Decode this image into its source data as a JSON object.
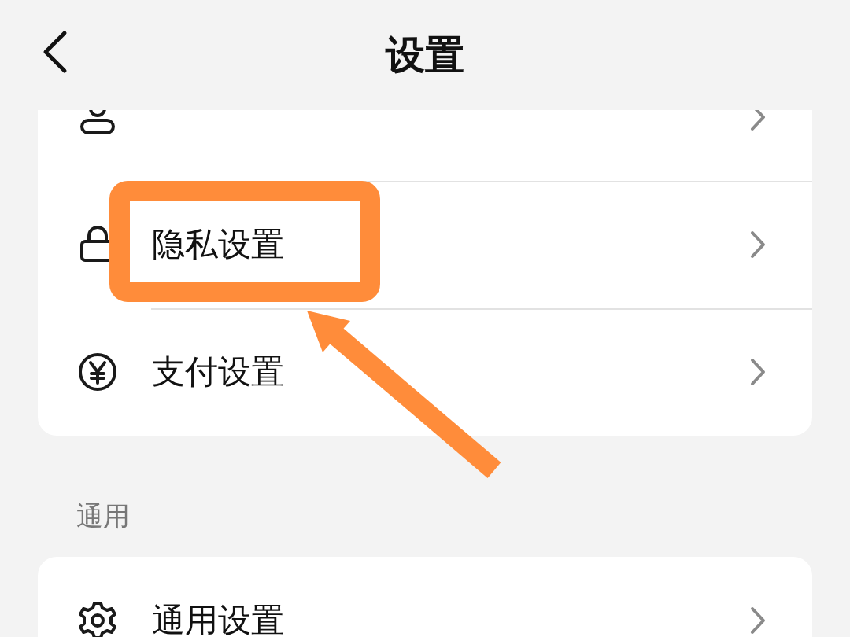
{
  "header": {
    "title": "设置"
  },
  "groups": [
    {
      "items": [
        {
          "kind": "user"
        },
        {
          "label": "隐私设置",
          "kind": "lock"
        },
        {
          "label": "支付设置",
          "kind": "yen"
        }
      ]
    },
    {
      "title": "通用",
      "items": [
        {
          "label": "通用设置",
          "kind": "gear"
        }
      ]
    }
  ]
}
